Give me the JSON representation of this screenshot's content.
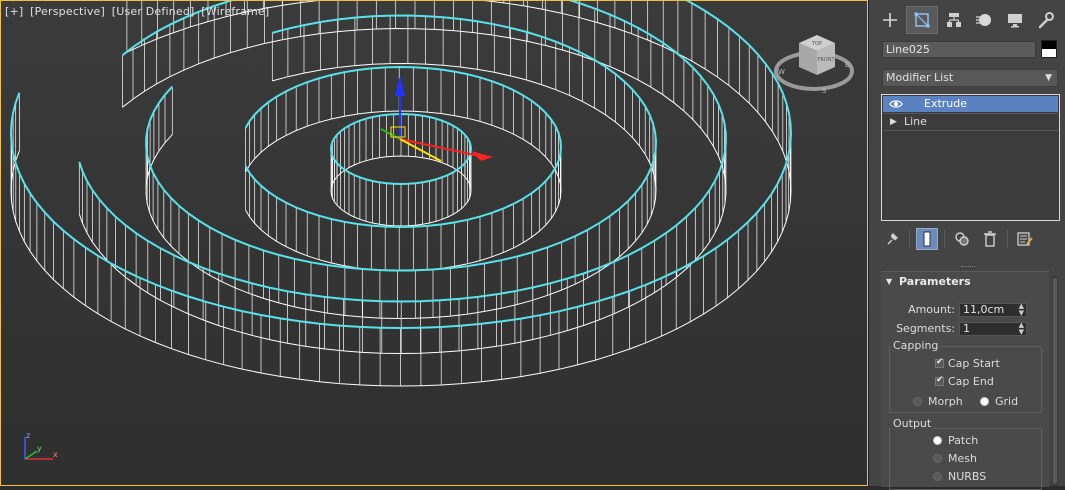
{
  "viewport": {
    "label_parts": [
      "[+]",
      "[Perspective]",
      "[User Defined]",
      "[Wireframe]"
    ],
    "viewcube": {
      "top": "TOP",
      "front": "FRONT",
      "compass_e": "E",
      "compass_w": "W",
      "compass_s": "S"
    },
    "tripod": {
      "x": "x",
      "y": "y",
      "z": "z"
    }
  },
  "command_panel": {
    "tabs": [
      "create-icon",
      "modify-icon",
      "hierarchy-icon",
      "motion-icon",
      "display-icon",
      "utilities-icon"
    ],
    "active_tab": "modify-icon",
    "object_name": "Line025",
    "modifier_list_label": "Modifier List",
    "stack": [
      {
        "label": "Extrude",
        "selected": true
      },
      {
        "label": "Line",
        "selected": false
      }
    ],
    "stack_tools": [
      "pin-stack-icon",
      "show-end-result-icon",
      "make-unique-icon",
      "remove-modifier-icon",
      "configure-modifier-sets-icon"
    ],
    "parameters": {
      "title": "Parameters",
      "amount_label": "Amount:",
      "amount_value": "11,0cm",
      "segments_label": "Segments:",
      "segments_value": "1",
      "capping": {
        "title": "Capping",
        "cap_start": "Cap Start",
        "cap_start_checked": true,
        "cap_end": "Cap End",
        "cap_end_checked": true,
        "morph": "Morph",
        "grid": "Grid",
        "selected": "Grid"
      },
      "output": {
        "title": "Output",
        "options": [
          "Patch",
          "Mesh",
          "NURBS"
        ],
        "selected": "Patch"
      }
    }
  },
  "colors": {
    "selection_outline": "#56e3ea",
    "wire": "#ffffff",
    "active_border": "#f0c040",
    "stack_selected": "#5a82c0"
  }
}
